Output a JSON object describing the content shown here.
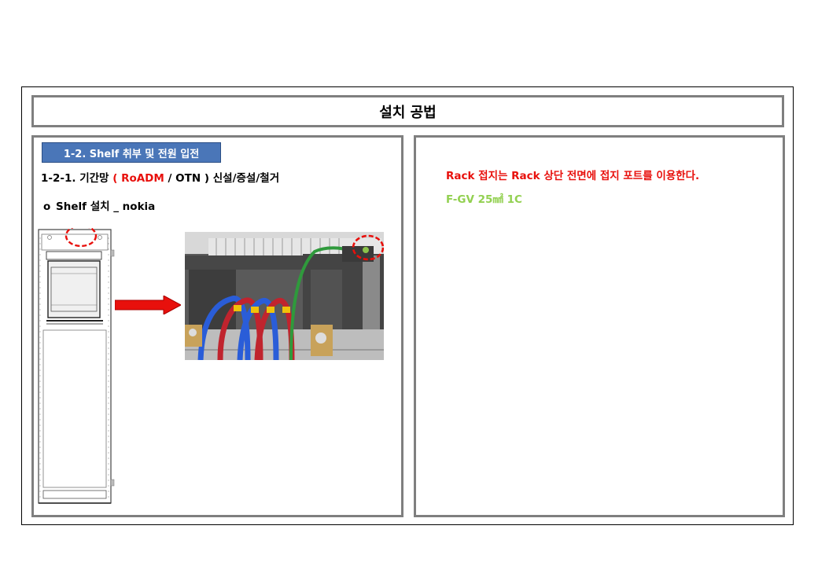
{
  "header": {
    "title": "설치 공법"
  },
  "left": {
    "section_badge": "1-2. Shelf 취부 및 전원 입전",
    "subheading": {
      "prefix": "1-2-1. 기간망 ",
      "paren_open": "( ",
      "roadm": "RoADM",
      "slash": " / ",
      "otn": "OTN ) ",
      "suffix": "신설/증설/철거"
    },
    "bullet": {
      "symbol": "o",
      "text": "Shelf 설치 _ nokia"
    }
  },
  "right": {
    "note_red": "Rack 접지는 Rack 상단 전면에 접지 포트를 이용한다.",
    "note_green": "F-GV 25㎟  1C"
  },
  "colors": {
    "panel_border": "#7f7f7f",
    "badge_bg": "#4a76b8",
    "accent_red": "#e8100c",
    "accent_green": "#92d050"
  }
}
